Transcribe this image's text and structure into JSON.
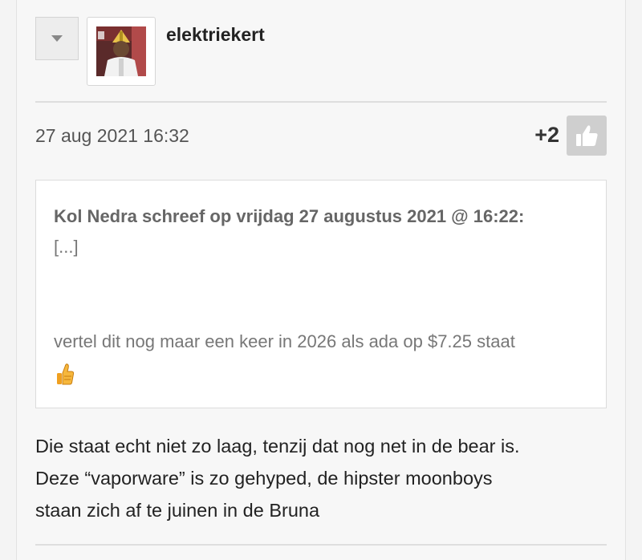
{
  "post": {
    "username": "elektriekert",
    "timestamp": "27 aug 2021 16:32",
    "score": "+2",
    "quote": {
      "attribution": "Kol Nedra schreef op vrijdag 27 augustus 2021 @ 16:22:",
      "ellipsis": "[...]",
      "text": "vertel dit nog maar een keer in 2026 als ada op $7.25 staat",
      "emoji": "thumbs-up-emoji"
    },
    "body_lines": [
      "Die staat echt niet zo laag, tenzij dat nog net in de bear is.",
      "Deze “vaporware” is zo gehyped, de hipster moonboys",
      "staan zich af te juinen in de Bruna"
    ]
  },
  "icons": {
    "collapse": "chevron-down-icon",
    "like": "thumbs-up-icon"
  },
  "colors": {
    "like_button_bg": "#cfcfcf",
    "quote_bg": "#ffffff",
    "page_bg": "#f7f7f7"
  }
}
